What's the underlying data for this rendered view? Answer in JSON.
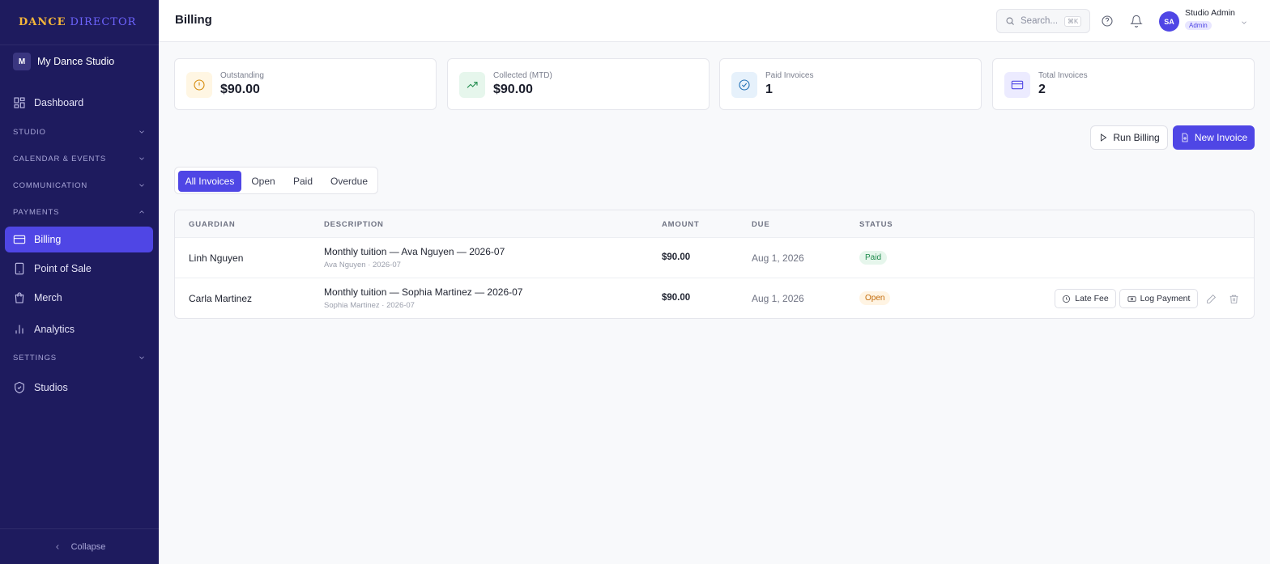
{
  "brand": {
    "word1": "DANCE",
    "word2": "DIRECTOR"
  },
  "studio": {
    "initial": "M",
    "name": "My Dance Studio"
  },
  "sidebar": {
    "dashboard": "Dashboard",
    "groups": {
      "studio": "STUDIO",
      "calendar": "CALENDAR & EVENTS",
      "communication": "COMMUNICATION",
      "payments": "PAYMENTS",
      "settings": "SETTINGS"
    },
    "payments_items": [
      "Billing",
      "Point of Sale",
      "Merch",
      "Analytics"
    ],
    "studios": "Studios",
    "collapse": "Collapse"
  },
  "header": {
    "title": "Billing",
    "search_placeholder": "Search...",
    "search_shortcut": "⌘K",
    "user": {
      "initials": "SA",
      "name": "Studio Admin",
      "role": "Admin"
    }
  },
  "stats": [
    {
      "label": "Outstanding",
      "value": "$90.00",
      "icon": "alert-circle-icon"
    },
    {
      "label": "Collected (MTD)",
      "value": "$90.00",
      "icon": "trending-up-icon"
    },
    {
      "label": "Paid Invoices",
      "value": "1",
      "icon": "check-circle-icon"
    },
    {
      "label": "Total Invoices",
      "value": "2",
      "icon": "credit-card-icon"
    }
  ],
  "actions": {
    "run_billing": "Run Billing",
    "new_invoice": "New Invoice"
  },
  "tabs": [
    "All Invoices",
    "Open",
    "Paid",
    "Overdue"
  ],
  "table": {
    "headers": {
      "guardian": "GUARDIAN",
      "description": "DESCRIPTION",
      "amount": "AMOUNT",
      "due": "DUE",
      "status": "STATUS"
    },
    "rows": [
      {
        "guardian": "Linh Nguyen",
        "description": "Monthly tuition — Ava Nguyen — 2026-07",
        "sub": "Ava Nguyen · 2026-07",
        "amount": "$90.00",
        "due": "Aug 1, 2026",
        "status": "Paid"
      },
      {
        "guardian": "Carla Martinez",
        "description": "Monthly tuition — Sophia Martinez — 2026-07",
        "sub": "Sophia Martinez · 2026-07",
        "amount": "$90.00",
        "due": "Aug 1, 2026",
        "status": "Open",
        "late_fee": "Late Fee",
        "log_payment": "Log Payment"
      }
    ]
  },
  "colors": {
    "sidebar": "#1e1b5e",
    "accent": "#4f46e5",
    "brand_gold": "#f5b63a",
    "paid": "#1f8a4c",
    "open": "#c36b0a"
  }
}
